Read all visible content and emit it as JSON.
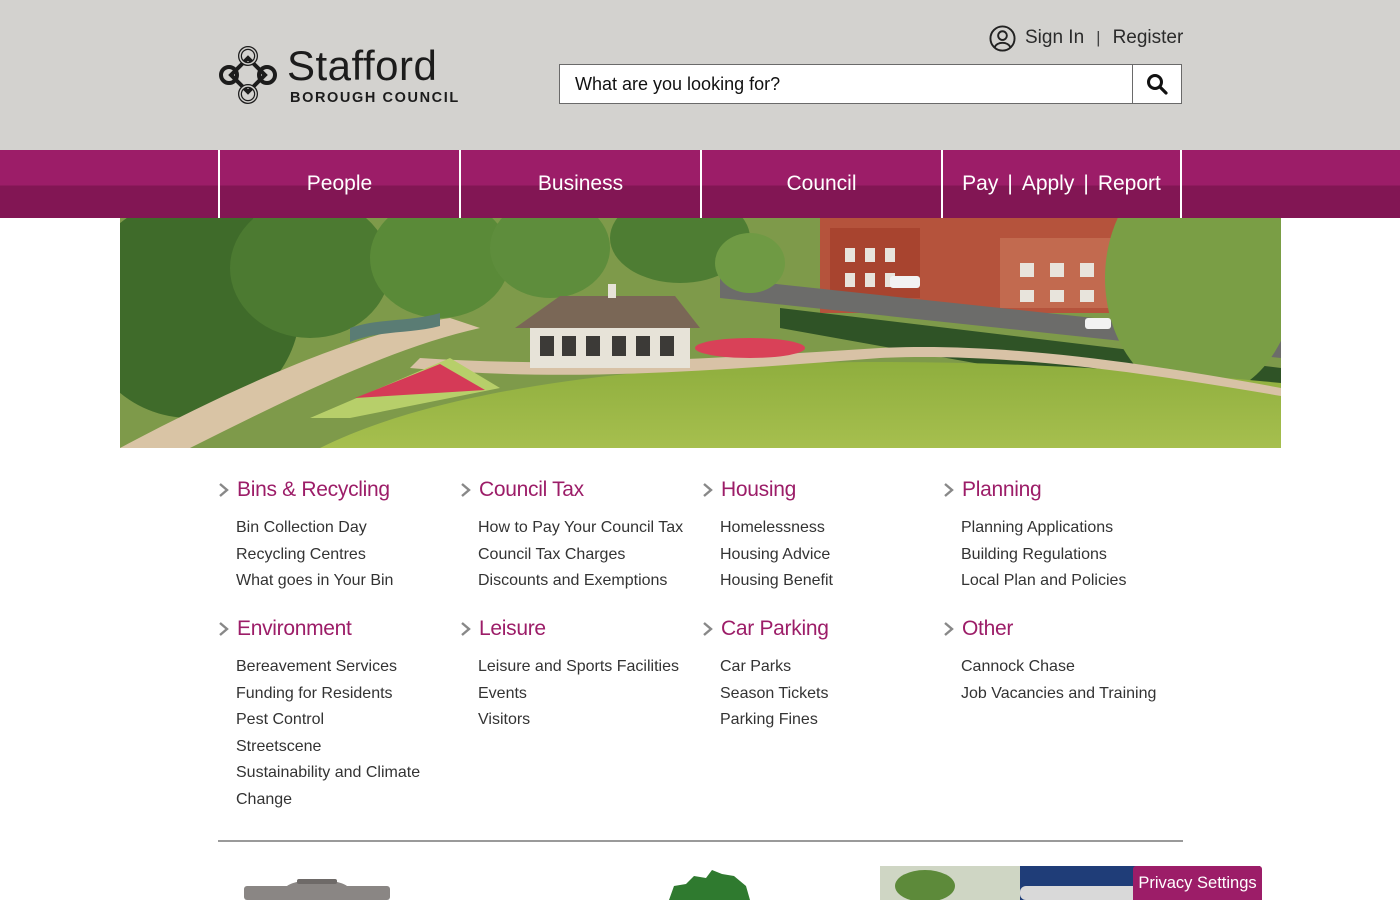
{
  "header": {
    "logo_name": "Stafford",
    "logo_sub": "BOROUGH COUNCIL",
    "sign_in": "Sign In",
    "separator": "|",
    "register": "Register",
    "search_placeholder": "What are you looking for?",
    "search_icon": "search-icon",
    "user_icon": "user-circle-icon"
  },
  "nav": {
    "people": "People",
    "business": "Business",
    "council": "Council",
    "pay": "Pay",
    "apply": "Apply",
    "report": "Report",
    "pipe": "|"
  },
  "colors": {
    "brand": "#9c1d68",
    "brand_dark": "#821654",
    "header_bg": "#d3d2cf"
  },
  "categories": [
    {
      "title": "Bins & Recycling",
      "links": [
        "Bin Collection Day",
        "Recycling Centres",
        "What goes in Your Bin"
      ]
    },
    {
      "title": "Council Tax",
      "links": [
        "How to Pay Your Council Tax",
        "Council Tax Charges",
        "Discounts and Exemptions"
      ]
    },
    {
      "title": "Housing",
      "links": [
        "Homelessness",
        "Housing Advice",
        "Housing Benefit"
      ]
    },
    {
      "title": "Planning",
      "links": [
        "Planning Applications",
        "Building Regulations",
        "Local Plan and Policies"
      ]
    },
    {
      "title": "Environment",
      "links": [
        "Bereavement Services",
        "Funding for Residents",
        "Pest Control",
        "Streetscene",
        "Sustainability and Climate",
        "Change"
      ]
    },
    {
      "title": "Leisure",
      "links": [
        "Leisure and Sports Facilities",
        "Events",
        "Visitors"
      ]
    },
    {
      "title": "Car Parking",
      "links": [
        "Car Parks",
        "Season Tickets",
        "Parking Fines"
      ]
    },
    {
      "title": "Other",
      "links": [
        "Cannock Chase",
        "Job Vacancies and Training"
      ]
    }
  ],
  "privacy_settings": "Privacy Settings"
}
